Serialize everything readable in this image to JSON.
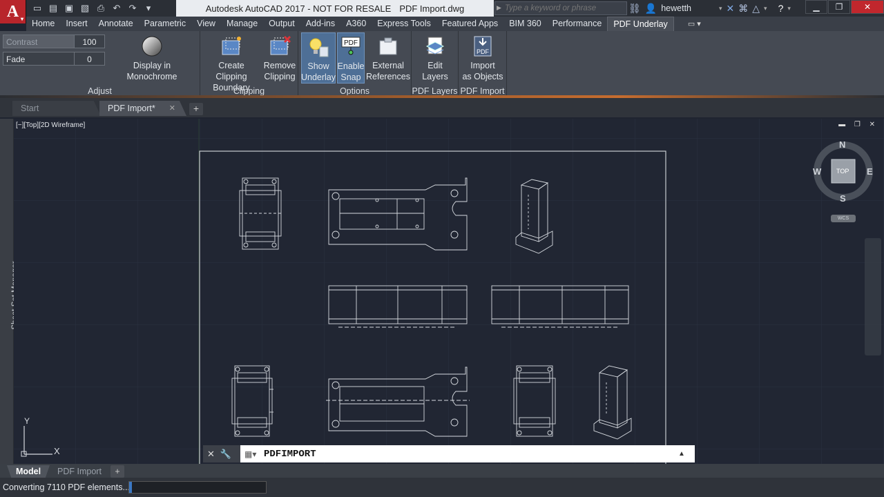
{
  "title_bar": {
    "app_name": "Autodesk AutoCAD 2017 - NOT FOR RESALE",
    "file_name": "PDF Import.dwg",
    "search_placeholder": "Type a keyword or phrase",
    "username": "hewetth"
  },
  "quick_access": [
    {
      "icon": "new-icon",
      "glyph": "▭"
    },
    {
      "icon": "open-icon",
      "glyph": "▤"
    },
    {
      "icon": "save-icon",
      "glyph": "▣"
    },
    {
      "icon": "save-as-icon",
      "glyph": "▧"
    },
    {
      "icon": "print-icon",
      "glyph": "⎙"
    },
    {
      "icon": "undo-icon",
      "glyph": "↶"
    },
    {
      "icon": "redo-icon",
      "glyph": "↷"
    },
    {
      "icon": "qat-dropdown-icon",
      "glyph": "▾"
    }
  ],
  "ribbon_tabs": [
    "Home",
    "Insert",
    "Annotate",
    "Parametric",
    "View",
    "Manage",
    "Output",
    "Add-ins",
    "A360",
    "Express Tools",
    "Featured Apps",
    "BIM 360",
    "Performance",
    "PDF Underlay"
  ],
  "active_ribbon_tab": "PDF Underlay",
  "ribbon": {
    "adjust": {
      "label": "Adjust",
      "contrast_label": "Contrast",
      "contrast_value": "100",
      "fade_label": "Fade",
      "fade_value": "0",
      "monochrome_label": "Display in Monochrome"
    },
    "clipping": {
      "label": "Clipping",
      "create_line1": "Create Clipping",
      "create_line2": "Boundary",
      "remove_line1": "Remove",
      "remove_line2": "Clipping"
    },
    "options": {
      "label": "Options",
      "show_line1": "Show",
      "show_line2": "Underlay",
      "snap_line1": "Enable",
      "snap_line2": "Snap",
      "ext_line1": "External",
      "ext_line2": "References"
    },
    "pdf_layers": {
      "label": "PDF Layers",
      "edit_line1": "Edit",
      "edit_line2": "Layers"
    },
    "pdf_import": {
      "label": "PDF Import",
      "import_line1": "Import",
      "import_line2": "as Objects"
    }
  },
  "doc_tabs": {
    "start": "Start",
    "current": "PDF Import*"
  },
  "viewport": {
    "label": "[−][Top][2D Wireframe]",
    "sheet_set_manager": "Sheet Set Manager",
    "compass": {
      "n": "N",
      "s": "S",
      "e": "E",
      "w": "W",
      "cube": "TOP",
      "wcs": "WCS"
    },
    "ucs_x": "X",
    "ucs_y": "Y"
  },
  "command_line": {
    "value": "PDFIMPORT"
  },
  "layout_tabs": {
    "model": "Model",
    "layout1": "PDF Import"
  },
  "status": {
    "text": "Converting 7110 PDF elements...",
    "progress": 0.02
  },
  "colors": {
    "accent_red": "#b8252b",
    "canvas": "#212633",
    "active_button": "#4e6f96"
  }
}
